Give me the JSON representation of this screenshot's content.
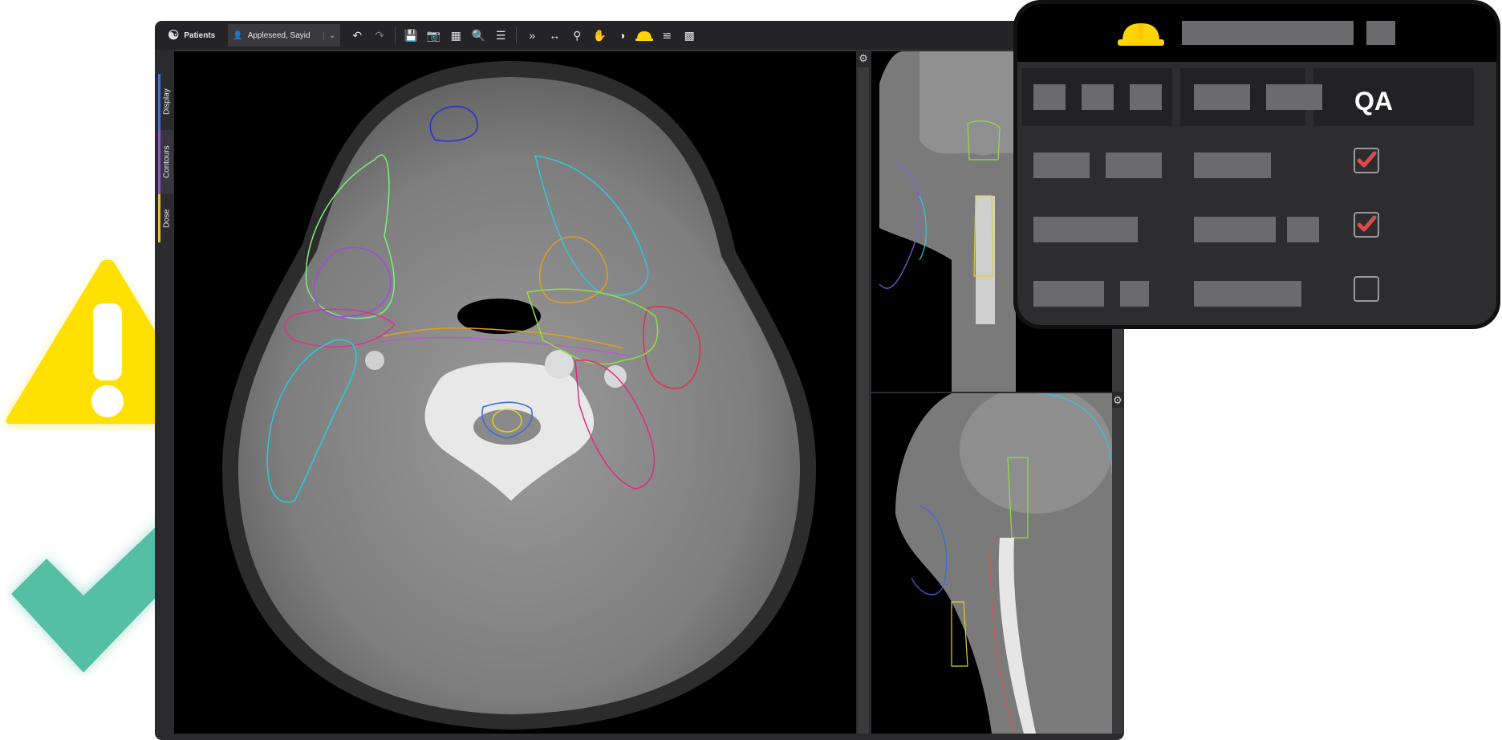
{
  "toolbar": {
    "patients_label": "Patients",
    "patient_name": "Appleseed, Sayid"
  },
  "side_tabs": {
    "display": "Display",
    "contours": "Contours",
    "dose": "Dose"
  },
  "qa_panel": {
    "header_icon": "hard-hat-icon",
    "qa_label": "QA",
    "rows": [
      {
        "checked": true
      },
      {
        "checked": true
      },
      {
        "checked": false
      }
    ]
  },
  "colors": {
    "warning_yellow": "#FFE000",
    "check_green": "#55BFA5",
    "checkbox_red": "#E04A4A",
    "hard_hat_yellow": "#FFD400"
  },
  "icons": {
    "warning": "warning-triangle-icon",
    "success": "checkmark-icon"
  }
}
